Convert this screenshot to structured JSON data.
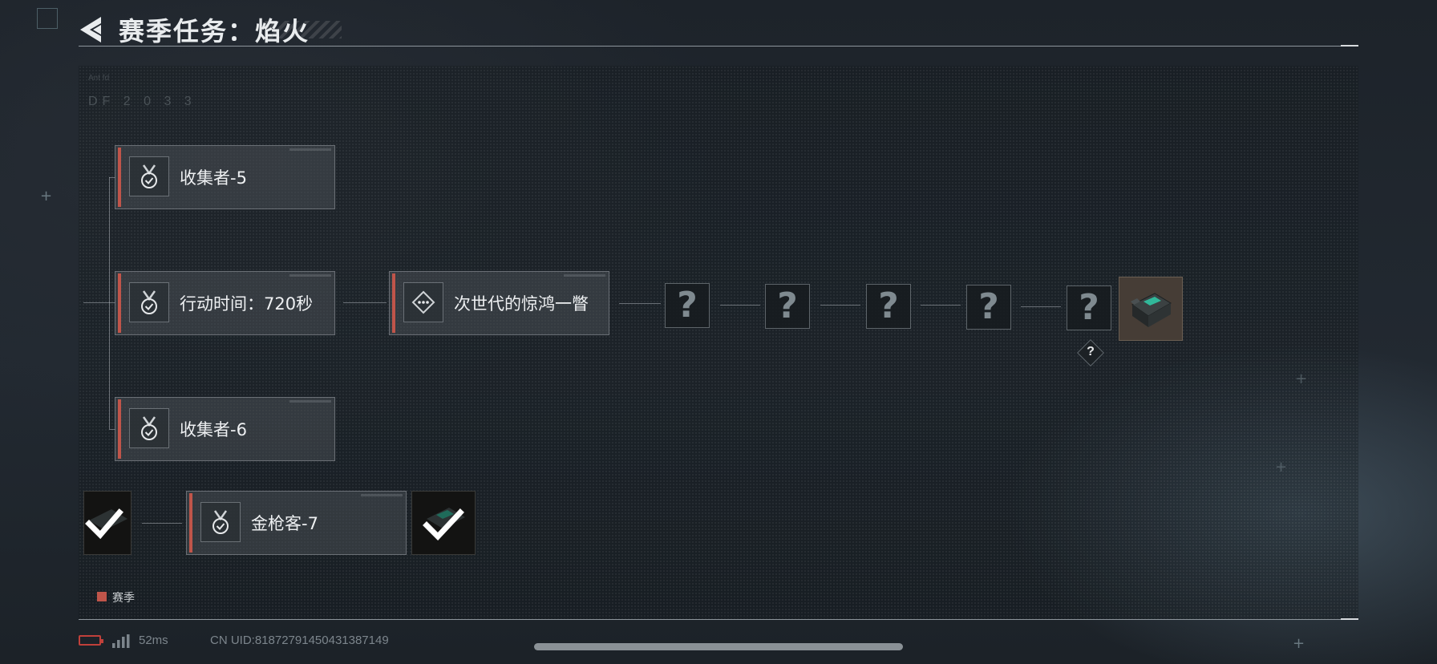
{
  "header": {
    "back_icon": "back-arrow-icon",
    "title": "赛季任务：焰火"
  },
  "background": {
    "code_text": "DF 2 0 3 3",
    "small_text": "Ant fd"
  },
  "tasks": {
    "collector5": {
      "label": "收集者-5",
      "icon": "medal-check-icon"
    },
    "action_time": {
      "label": "行动时间：720秒",
      "icon": "medal-check-icon"
    },
    "next_gen": {
      "label": "次世代的惊鸿一瞥",
      "icon": "diamond-dots-icon"
    },
    "collector6": {
      "label": "收集者-6",
      "icon": "medal-check-icon"
    },
    "golden_gun7": {
      "label": "金枪客-7",
      "icon": "medal-check-icon"
    }
  },
  "locked_tasks": [
    {
      "label": "?"
    },
    {
      "label": "?"
    },
    {
      "label": "?"
    },
    {
      "label": "?"
    },
    {
      "label": "?"
    }
  ],
  "final_reward": {
    "hint": "?",
    "icon": "gear-case-icon"
  },
  "completed_rewards": [
    "checkmark-icon",
    "checkmark-icon"
  ],
  "legend": {
    "label": "赛季",
    "color": "#c0554a"
  },
  "status_bar": {
    "ping": "52ms",
    "uid": "CN UID:81872791450431387149",
    "battery_color": "#c0403a"
  }
}
